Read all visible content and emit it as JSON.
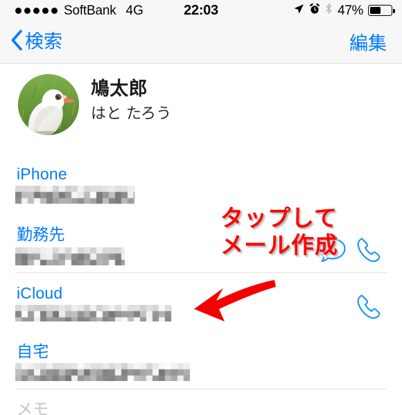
{
  "status_bar": {
    "signal_dots": 5,
    "carrier": "SoftBank",
    "network": "4G",
    "time": "22:03",
    "battery_percent": "47%",
    "battery_level": 47,
    "icons": [
      "location-arrow-icon",
      "alarm-clock-icon",
      "bluetooth-icon"
    ]
  },
  "nav_bar": {
    "back_label": "検索",
    "edit_label": "編集"
  },
  "contact": {
    "name": "鳩太郎",
    "reading": "はと たろう",
    "avatar_alt": "white-pigeon-photo"
  },
  "fields": [
    {
      "label": "iPhone",
      "value_redacted": true,
      "actions": [
        "message-icon",
        "phone-icon"
      ]
    },
    {
      "label": "勤務先",
      "value_redacted": true,
      "actions": [
        "phone-icon"
      ]
    },
    {
      "label": "iCloud",
      "value_redacted": true,
      "actions": []
    },
    {
      "label": "自宅",
      "value_redacted": true,
      "actions": []
    },
    {
      "label": "メモ",
      "value_redacted": false,
      "muted": true,
      "actions": []
    }
  ],
  "annotation": {
    "line1": "タップして",
    "line2": "メール作成",
    "color": "#ff0000",
    "arrow": "red-arrow-pointing-left"
  },
  "colors": {
    "accent_blue": "#007aff",
    "annotation_red": "#ff0000",
    "bar_background": "#f7f7f7",
    "separator": "#e2e2e4",
    "muted_text": "#c6c6c9"
  }
}
